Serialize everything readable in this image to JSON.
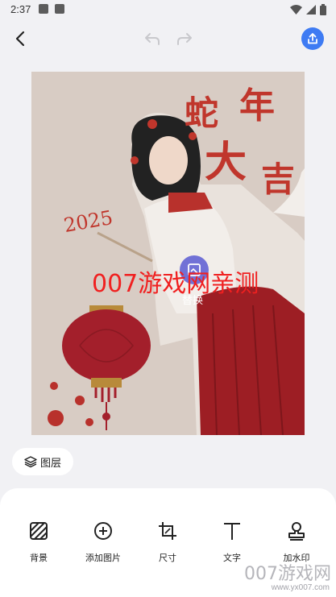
{
  "status_bar": {
    "time": "2:37"
  },
  "canvas": {
    "poster_title_chars": [
      "蛇",
      "年",
      "大",
      "吉"
    ],
    "poster_year": "2025",
    "overlay_text": "007游戏网亲测",
    "replace_label": "替换"
  },
  "layers_button": {
    "label": "图层"
  },
  "bottom_tools": [
    {
      "label": "背景",
      "icon": "background-icon"
    },
    {
      "label": "添加图片",
      "icon": "add-image-icon"
    },
    {
      "label": "尺寸",
      "icon": "crop-size-icon"
    },
    {
      "label": "文字",
      "icon": "text-icon"
    },
    {
      "label": "加水印",
      "icon": "stamp-icon"
    }
  ],
  "site_watermark": {
    "logo": "007游戏网",
    "url": "www.yx007.com"
  },
  "colors": {
    "accent": "#3e7bf3",
    "poster_bg": "#d8ccc4",
    "title_red": "#c0362c",
    "overlay_red": "#f02020"
  }
}
